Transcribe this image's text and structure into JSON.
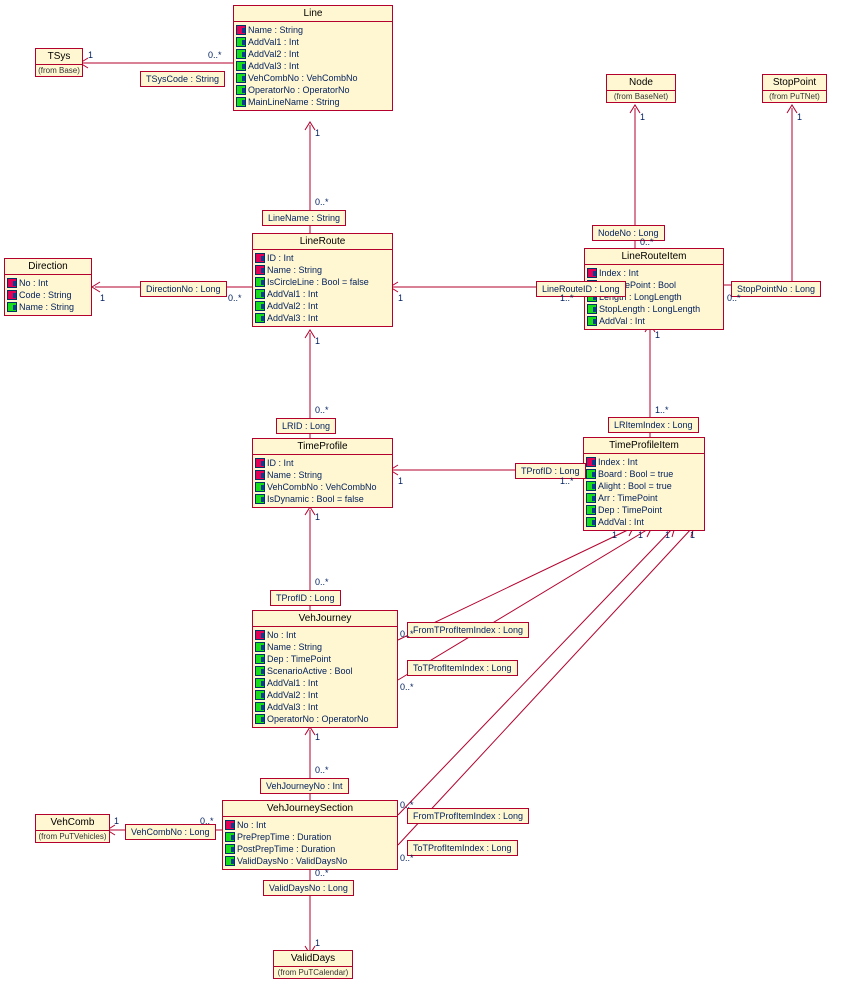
{
  "classes": {
    "tsys": {
      "title": "TSys",
      "from": "(from Base)"
    },
    "line": {
      "title": "Line",
      "attrs": [
        [
          "pk",
          "Name : String"
        ],
        [
          "",
          "AddVal1 : Int"
        ],
        [
          "",
          "AddVal2 : Int"
        ],
        [
          "",
          "AddVal3 : Int"
        ],
        [
          "",
          "VehCombNo : VehCombNo"
        ],
        [
          "",
          "OperatorNo : OperatorNo"
        ],
        [
          "",
          "MainLineName : String"
        ]
      ]
    },
    "node": {
      "title": "Node",
      "from": "(from BaseNet)"
    },
    "stoppoint": {
      "title": "StopPoint",
      "from": "(from PuTNet)"
    },
    "direction": {
      "title": "Direction",
      "attrs": [
        [
          "pk",
          "No : Int"
        ],
        [
          "pk",
          "Code : String"
        ],
        [
          "",
          "Name : String"
        ]
      ]
    },
    "lineroute": {
      "title": "LineRoute",
      "attrs": [
        [
          "pk",
          "ID : Int"
        ],
        [
          "pk",
          "Name : String"
        ],
        [
          "",
          "IsCircleLine : Bool = false"
        ],
        [
          "",
          "AddVal1 : Int"
        ],
        [
          "",
          "AddVal2 : Int"
        ],
        [
          "",
          "AddVal3 : Int"
        ]
      ]
    },
    "linerouteitem": {
      "title": "LineRouteItem",
      "attrs": [
        [
          "pk",
          "Index : Int"
        ],
        [
          "",
          "IsRoutePoint : Bool"
        ],
        [
          "",
          "Length : LongLength"
        ],
        [
          "",
          "StopLength : LongLength"
        ],
        [
          "",
          "AddVal : Int"
        ]
      ]
    },
    "timeprofile": {
      "title": "TimeProfile",
      "attrs": [
        [
          "pk",
          "ID : Int"
        ],
        [
          "pk",
          "Name : String"
        ],
        [
          "",
          "VehCombNo : VehCombNo"
        ],
        [
          "",
          "IsDynamic : Bool = false"
        ]
      ]
    },
    "timeprofileitem": {
      "title": "TimeProfileItem",
      "attrs": [
        [
          "pk",
          "Index : Int"
        ],
        [
          "",
          "Board : Bool = true"
        ],
        [
          "",
          "Alight : Bool = true"
        ],
        [
          "",
          "Arr : TimePoint"
        ],
        [
          "",
          "Dep : TimePoint"
        ],
        [
          "",
          "AddVal : Int"
        ]
      ]
    },
    "vehjourney": {
      "title": "VehJourney",
      "attrs": [
        [
          "pk",
          "No : Int"
        ],
        [
          "",
          "Name : String"
        ],
        [
          "",
          "Dep : TimePoint"
        ],
        [
          "",
          "ScenarioActive : Bool"
        ],
        [
          "",
          "AddVal1 : Int"
        ],
        [
          "",
          "AddVal2 : Int"
        ],
        [
          "",
          "AddVal3 : Int"
        ],
        [
          "",
          "OperatorNo : OperatorNo"
        ]
      ]
    },
    "vehjourneysection": {
      "title": "VehJourneySection",
      "attrs": [
        [
          "pk",
          "No : Int"
        ],
        [
          "",
          "PrePrepTime : Duration"
        ],
        [
          "",
          "PostPrepTime : Duration"
        ],
        [
          "",
          "ValidDaysNo : ValidDaysNo"
        ]
      ]
    },
    "vehcomb": {
      "title": "VehComb",
      "from": "(from PuTVehicles)"
    },
    "validdays": {
      "title": "ValidDays",
      "from": "(from PuTCalendar)"
    }
  },
  "assoc": {
    "tsyscode": "TSysCode : String",
    "linename": "LineName : String",
    "directionno": "DirectionNo : Long",
    "nodeno": "NodeNo : Long",
    "stoppointno": "StopPointNo : Long",
    "linerouteid": "LineRouteID : Long",
    "lrid": "LRID : Long",
    "tprofid": "TProfID : Long",
    "tprofid2": "TProfID : Long",
    "lritemindex": "LRItemIndex : Long",
    "fromtprofitemindex": "FromTProfItemIndex : Long",
    "totprofitemindex": "ToTProfItemIndex : Long",
    "fromtprofitemindex2": "FromTProfItemIndex : Long",
    "totprofitemindex2": "ToTProfItemIndex : Long",
    "vehjourneyno": "VehJourneyNo : Int",
    "vehcombno": "VehCombNo : Long",
    "validdaysno": "ValidDaysNo : Long"
  },
  "mult": {
    "one": "1",
    "many": "0..*",
    "onemany": "1..*"
  }
}
